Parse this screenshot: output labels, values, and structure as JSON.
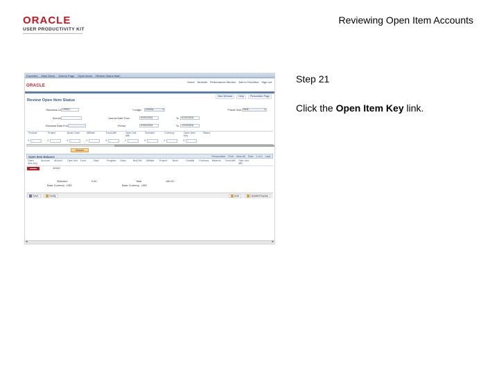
{
  "header": {
    "logo_word": "ORACLE",
    "logo_sub": "USER PRODUCTIVITY KIT",
    "title": "Reviewing Open Item Accounts"
  },
  "instructions": {
    "step": "Step 21",
    "text_before": "Click the ",
    "link_name": "Open Item Key",
    "text_after": " link."
  },
  "screenshot": {
    "menubar": [
      "Favorites",
      "Main Menu",
      "Search Page",
      "Open Items",
      "Review Status Main"
    ],
    "logo": "ORACLE",
    "toplinks": [
      "Home",
      "Worklist",
      "Performance Monitor",
      "Add to Favorites",
      "Sign out"
    ],
    "window_links": [
      "New Window",
      "Help",
      "Personalize Page"
    ],
    "page_title": "Review Open Item Status",
    "fields": {
      "business_unit_label": "*Business Unit",
      "business_unit_value": "US001",
      "ledger_label": "*Ledger",
      "ledger_value": "LOCAL",
      "fiscal_year_label": "*Fiscal Year",
      "fiscal_year_value": "2011",
      "account_label": "Account",
      "account_value": "",
      "journal_date_from_label": "Journal Date From",
      "journal_date_from_value": "01/01/2011",
      "to_label": "To",
      "to_value": "01/31/2011",
      "period_label": "Period",
      "period_value": "",
      "reversal_date_label": "Reversal Date From",
      "reversal_date_value": "01/01/2011",
      "to2_label": "To",
      "to2_value": "12/31/2011"
    },
    "grid_headers": [
      "Product",
      "Project",
      "Book Code",
      "Affiliate",
      "Fund Affil",
      "Oper Unit Affil",
      "Scenario",
      "Currency",
      "Open Item Key",
      "Status"
    ],
    "search_button": "Search",
    "open_item_balance": {
      "title": "Open Item Balance",
      "nav": [
        "Personalize",
        "Find",
        "View All",
        "First",
        "1 of 1",
        "Last"
      ],
      "columns": [
        "Open Item Key",
        "Account",
        "Alt Acct",
        "Oper Unit",
        "Fund",
        "Dept",
        "Program",
        "Class",
        "Bud Ref",
        "Affiliate",
        "Project",
        "Book",
        "Chartfld",
        "Currency",
        "Balance",
        "Fund Affil",
        "Oper Unit Affil"
      ],
      "row_value": "10140"
    },
    "totals": {
      "selected_label": "Selected",
      "selected_value": "0.00",
      "total_label": "Total",
      "total_value": "150.00",
      "base_currency_label": "Base Currency",
      "base_currency_value": "USD"
    },
    "buttons": {
      "save": "Save",
      "notify": "Notify",
      "add": "Add",
      "update_display": "Update/Display"
    }
  }
}
